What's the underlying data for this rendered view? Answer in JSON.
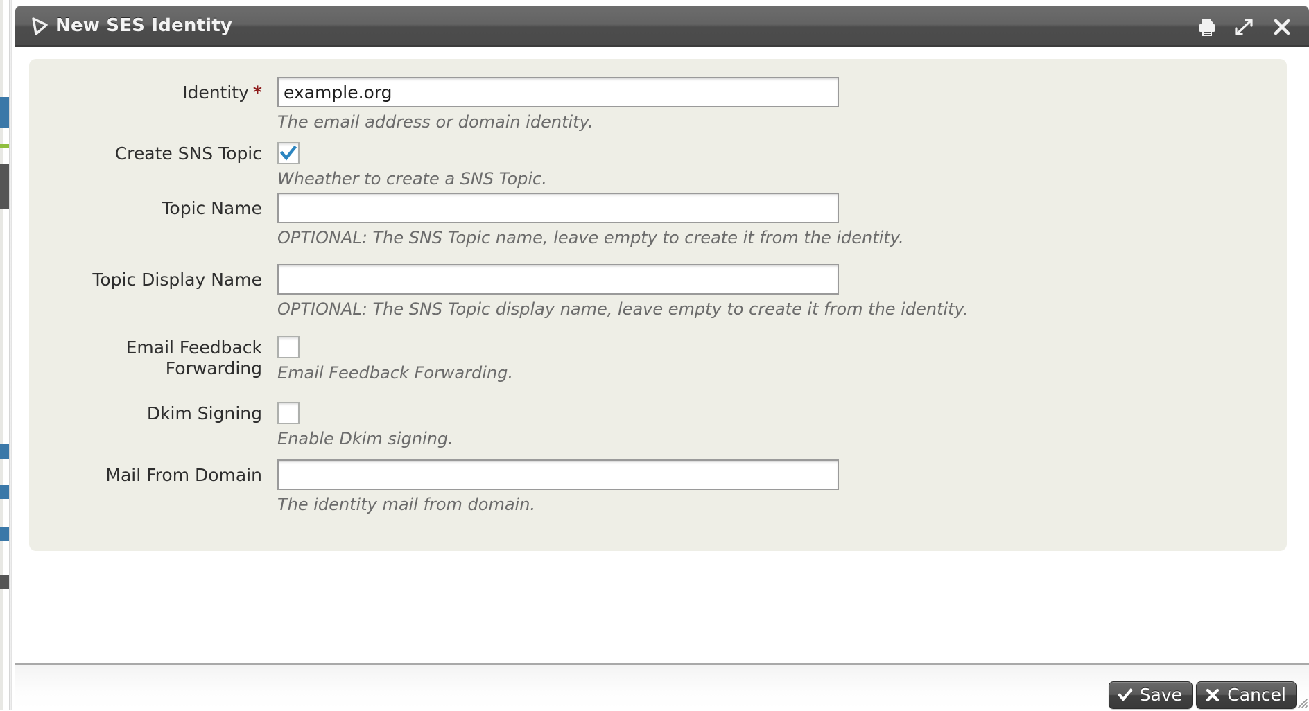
{
  "window": {
    "title": "New SES Identity",
    "icon": "triangle-flag-icon",
    "controls": [
      {
        "name": "print",
        "icon": "printer-icon"
      },
      {
        "name": "expand",
        "icon": "expand-arrows-icon"
      },
      {
        "name": "close",
        "icon": "close-x-icon"
      }
    ]
  },
  "colors": {
    "titlebar": "#5a5a5a",
    "panel": "#eeeee6",
    "required_asterisk": "#8d1a1a",
    "checkbox_check": "#2b85c0",
    "hint_text": "#6b6b6b",
    "input_border": "#9a9a9a"
  },
  "form": {
    "fields": [
      {
        "label": "Identity",
        "required": true,
        "required_marker": "*",
        "type": "text",
        "value": "example.org",
        "placeholder": "",
        "hint": "The email address or domain identity."
      },
      {
        "label": "Create SNS Topic",
        "required": false,
        "type": "checkbox",
        "checked": true,
        "hint": "Wheather to create a SNS Topic."
      },
      {
        "label": "Topic Name",
        "required": false,
        "type": "text",
        "value": "",
        "placeholder": "",
        "hint": "OPTIONAL: The SNS Topic name, leave empty to create it from the identity."
      },
      {
        "label": "Topic Display Name",
        "required": false,
        "type": "text",
        "value": "",
        "placeholder": "",
        "hint": "OPTIONAL: The SNS Topic display name, leave empty to create it from the identity."
      },
      {
        "label": "Email Feedback Forwarding",
        "required": false,
        "type": "checkbox",
        "checked": false,
        "hint": "Email Feedback Forwarding."
      },
      {
        "label": "Dkim Signing",
        "required": false,
        "type": "checkbox",
        "checked": false,
        "hint": "Enable Dkim signing."
      },
      {
        "label": "Mail From Domain",
        "required": false,
        "type": "text",
        "value": "",
        "placeholder": "",
        "hint": "The identity mail from domain."
      }
    ]
  },
  "footer": {
    "save_label": "Save",
    "save_icon": "check-icon",
    "cancel_label": "Cancel",
    "cancel_icon": "close-x-icon"
  }
}
